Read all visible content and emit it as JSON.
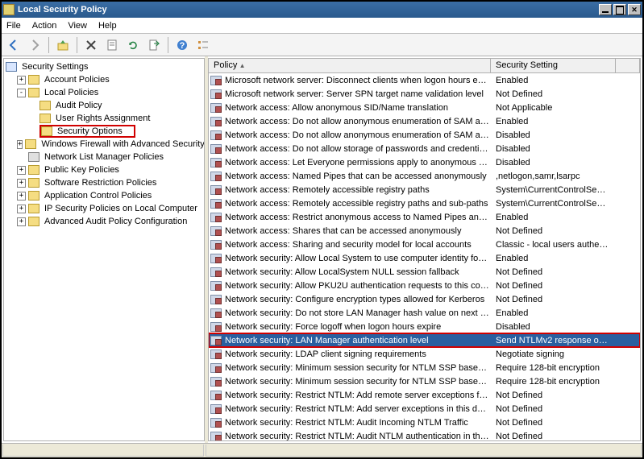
{
  "title": "Local Security Policy",
  "menu": {
    "file": "File",
    "action": "Action",
    "view": "View",
    "help": "Help"
  },
  "toolbar_icons": [
    "back",
    "forward",
    "up",
    "properties",
    "delete",
    "refresh",
    "export",
    "help",
    "list"
  ],
  "tree": {
    "root": "Security Settings",
    "items": [
      {
        "label": "Account Policies",
        "indent": 1,
        "exp": "+"
      },
      {
        "label": "Local Policies",
        "indent": 1,
        "exp": "-"
      },
      {
        "label": "Audit Policy",
        "indent": 2,
        "exp": " "
      },
      {
        "label": "User Rights Assignment",
        "indent": 2,
        "exp": " "
      },
      {
        "label": "Security Options",
        "indent": 2,
        "exp": " ",
        "highlight": true
      },
      {
        "label": "Windows Firewall with Advanced Security",
        "indent": 1,
        "exp": "+"
      },
      {
        "label": "Network List Manager Policies",
        "indent": 1,
        "exp": " ",
        "doc": true
      },
      {
        "label": "Public Key Policies",
        "indent": 1,
        "exp": "+"
      },
      {
        "label": "Software Restriction Policies",
        "indent": 1,
        "exp": "+"
      },
      {
        "label": "Application Control Policies",
        "indent": 1,
        "exp": "+"
      },
      {
        "label": "IP Security Policies on Local Computer",
        "indent": 1,
        "exp": "+"
      },
      {
        "label": "Advanced Audit Policy Configuration",
        "indent": 1,
        "exp": "+"
      }
    ]
  },
  "list": {
    "headers": {
      "policy": "Policy",
      "setting": "Security Setting"
    },
    "rows": [
      {
        "policy": "Microsoft network server: Disconnect clients when logon hours e…",
        "setting": "Enabled"
      },
      {
        "policy": "Microsoft network server: Server SPN target name validation level",
        "setting": "Not Defined"
      },
      {
        "policy": "Network access: Allow anonymous SID/Name translation",
        "setting": "Not Applicable"
      },
      {
        "policy": "Network access: Do not allow anonymous enumeration of SAM ac…",
        "setting": "Enabled"
      },
      {
        "policy": "Network access: Do not allow anonymous enumeration of SAM ac…",
        "setting": "Disabled"
      },
      {
        "policy": "Network access: Do not allow storage of passwords and credenti…",
        "setting": "Disabled"
      },
      {
        "policy": "Network access: Let Everyone permissions apply to anonymous u…",
        "setting": "Disabled"
      },
      {
        "policy": "Network access: Named Pipes that can be accessed anonymously",
        "setting": ",netlogon,samr,lsarpc"
      },
      {
        "policy": "Network access: Remotely accessible registry paths",
        "setting": "System\\CurrentControlSe…"
      },
      {
        "policy": "Network access: Remotely accessible registry paths and sub-paths",
        "setting": "System\\CurrentControlSe…"
      },
      {
        "policy": "Network access: Restrict anonymous access to Named Pipes and …",
        "setting": "Enabled"
      },
      {
        "policy": "Network access: Shares that can be accessed anonymously",
        "setting": "Not Defined"
      },
      {
        "policy": "Network access: Sharing and security model for local accounts",
        "setting": "Classic - local users authe…"
      },
      {
        "policy": "Network security: Allow Local System to use computer identity fo…",
        "setting": "Enabled"
      },
      {
        "policy": "Network security: Allow LocalSystem NULL session fallback",
        "setting": "Not Defined"
      },
      {
        "policy": "Network security: Allow PKU2U authentication requests to this co…",
        "setting": "Not Defined"
      },
      {
        "policy": "Network security: Configure encryption types allowed for Kerberos",
        "setting": "Not Defined"
      },
      {
        "policy": "Network security: Do not store LAN Manager hash value on next …",
        "setting": "Enabled"
      },
      {
        "policy": "Network security: Force logoff when logon hours expire",
        "setting": "Disabled"
      },
      {
        "policy": "Network security: LAN Manager authentication level",
        "setting": "Send NTLMv2 response o…",
        "selected": true
      },
      {
        "policy": "Network security: LDAP client signing requirements",
        "setting": "Negotiate signing"
      },
      {
        "policy": "Network security: Minimum session security for NTLM SSP based (…",
        "setting": "Require 128-bit encryption"
      },
      {
        "policy": "Network security: Minimum session security for NTLM SSP based (…",
        "setting": "Require 128-bit encryption"
      },
      {
        "policy": "Network security: Restrict NTLM: Add remote server exceptions f…",
        "setting": "Not Defined"
      },
      {
        "policy": "Network security: Restrict NTLM: Add server exceptions in this d…",
        "setting": "Not Defined"
      },
      {
        "policy": "Network security: Restrict NTLM: Audit Incoming NTLM Traffic",
        "setting": "Not Defined"
      },
      {
        "policy": "Network security: Restrict NTLM: Audit NTLM authentication in thi…",
        "setting": "Not Defined"
      }
    ]
  }
}
